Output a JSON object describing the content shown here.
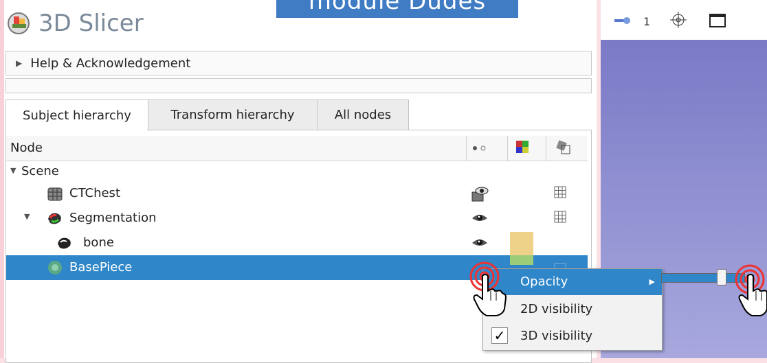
{
  "banner": {
    "title": "module Dudes"
  },
  "app": {
    "title": "3D Slicer"
  },
  "sections": [
    {
      "label": "Help & Acknowledgement"
    },
    {
      "label": ""
    }
  ],
  "tabs": [
    {
      "label": "Subject hierarchy"
    },
    {
      "label": "Transform hierarchy"
    },
    {
      "label": "All nodes"
    }
  ],
  "tree": {
    "header": {
      "node": "Node",
      "visibility_icon": "eye-toggle-icon",
      "color_icon": "color-icon",
      "transform_icon": "transform-icon"
    },
    "rows": [
      {
        "label": "Scene",
        "icon": "none",
        "visibility": "none",
        "color": "",
        "transform": false
      },
      {
        "label": "CTChest",
        "icon": "volume-icon",
        "visibility": "volume-eye-icon",
        "color": "",
        "transform": true
      },
      {
        "label": "Segmentation",
        "icon": "segmentation-icon",
        "visibility": "eye-icon",
        "color": "",
        "transform": true
      },
      {
        "label": "bone",
        "icon": "segment-icon",
        "visibility": "eye-icon",
        "color": "#eed28a",
        "transform": false
      },
      {
        "label": "BasePiece",
        "icon": "segment-icon",
        "visibility": "eye-icon",
        "color": "#9ccc78",
        "transform": true,
        "selected": true
      }
    ]
  },
  "context_menu": {
    "items": [
      {
        "label": "Opacity",
        "has_submenu": true,
        "highlighted": true
      },
      {
        "label": "2D visibility",
        "checked": false
      },
      {
        "label": "3D visibility",
        "checked": true
      }
    ],
    "opacity_slider": {
      "value": 0.75
    }
  },
  "view": {
    "layout_number": "1"
  },
  "colors": {
    "accent": "#2f86c9",
    "banner": "#3f7cc4",
    "view_bg_top": "#7474c4",
    "view_bg_bottom": "#a8a8de"
  }
}
